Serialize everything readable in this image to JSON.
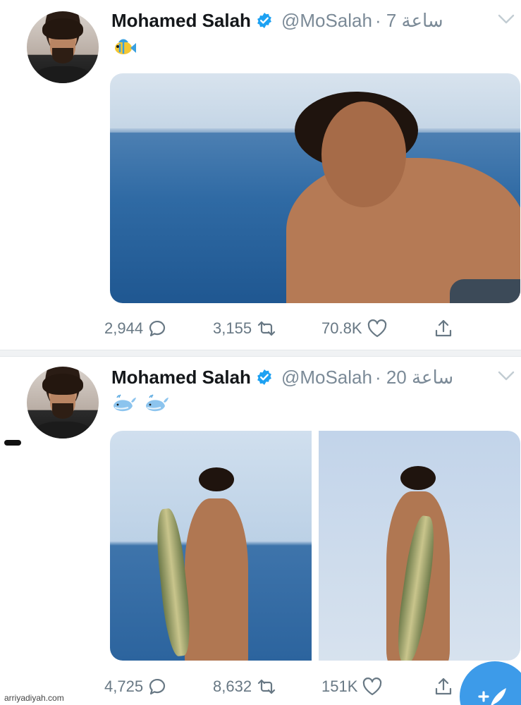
{
  "tweets": [
    {
      "author": {
        "name": "Mohamed Salah",
        "handle": "@MoSalah",
        "time": "· 7 ساعة"
      },
      "emoji": [
        "tropical-fish"
      ],
      "media": "single",
      "stats": {
        "replies": "2,944",
        "retweets": "3,155",
        "likes": "70.8K"
      }
    },
    {
      "author": {
        "name": "Mohamed Salah",
        "handle": "@MoSalah",
        "time": "· 20 ساعة"
      },
      "emoji": [
        "whale",
        "whale"
      ],
      "media": "double",
      "stats": {
        "replies": "4,725",
        "retweets": "8,632",
        "likes": "151K"
      }
    }
  ],
  "colors": {
    "accent": "#1da1f2",
    "verified": "#1da1f2",
    "muted": "#7b8a97",
    "compose": "#3d9be9"
  },
  "icons": {
    "reply": "reply-icon",
    "retweet": "retweet-icon",
    "like": "heart-icon",
    "share": "share-icon",
    "compose": "compose-tweet-icon",
    "menu": "chevron-down-icon"
  },
  "watermark": "arriyadiyah.com"
}
